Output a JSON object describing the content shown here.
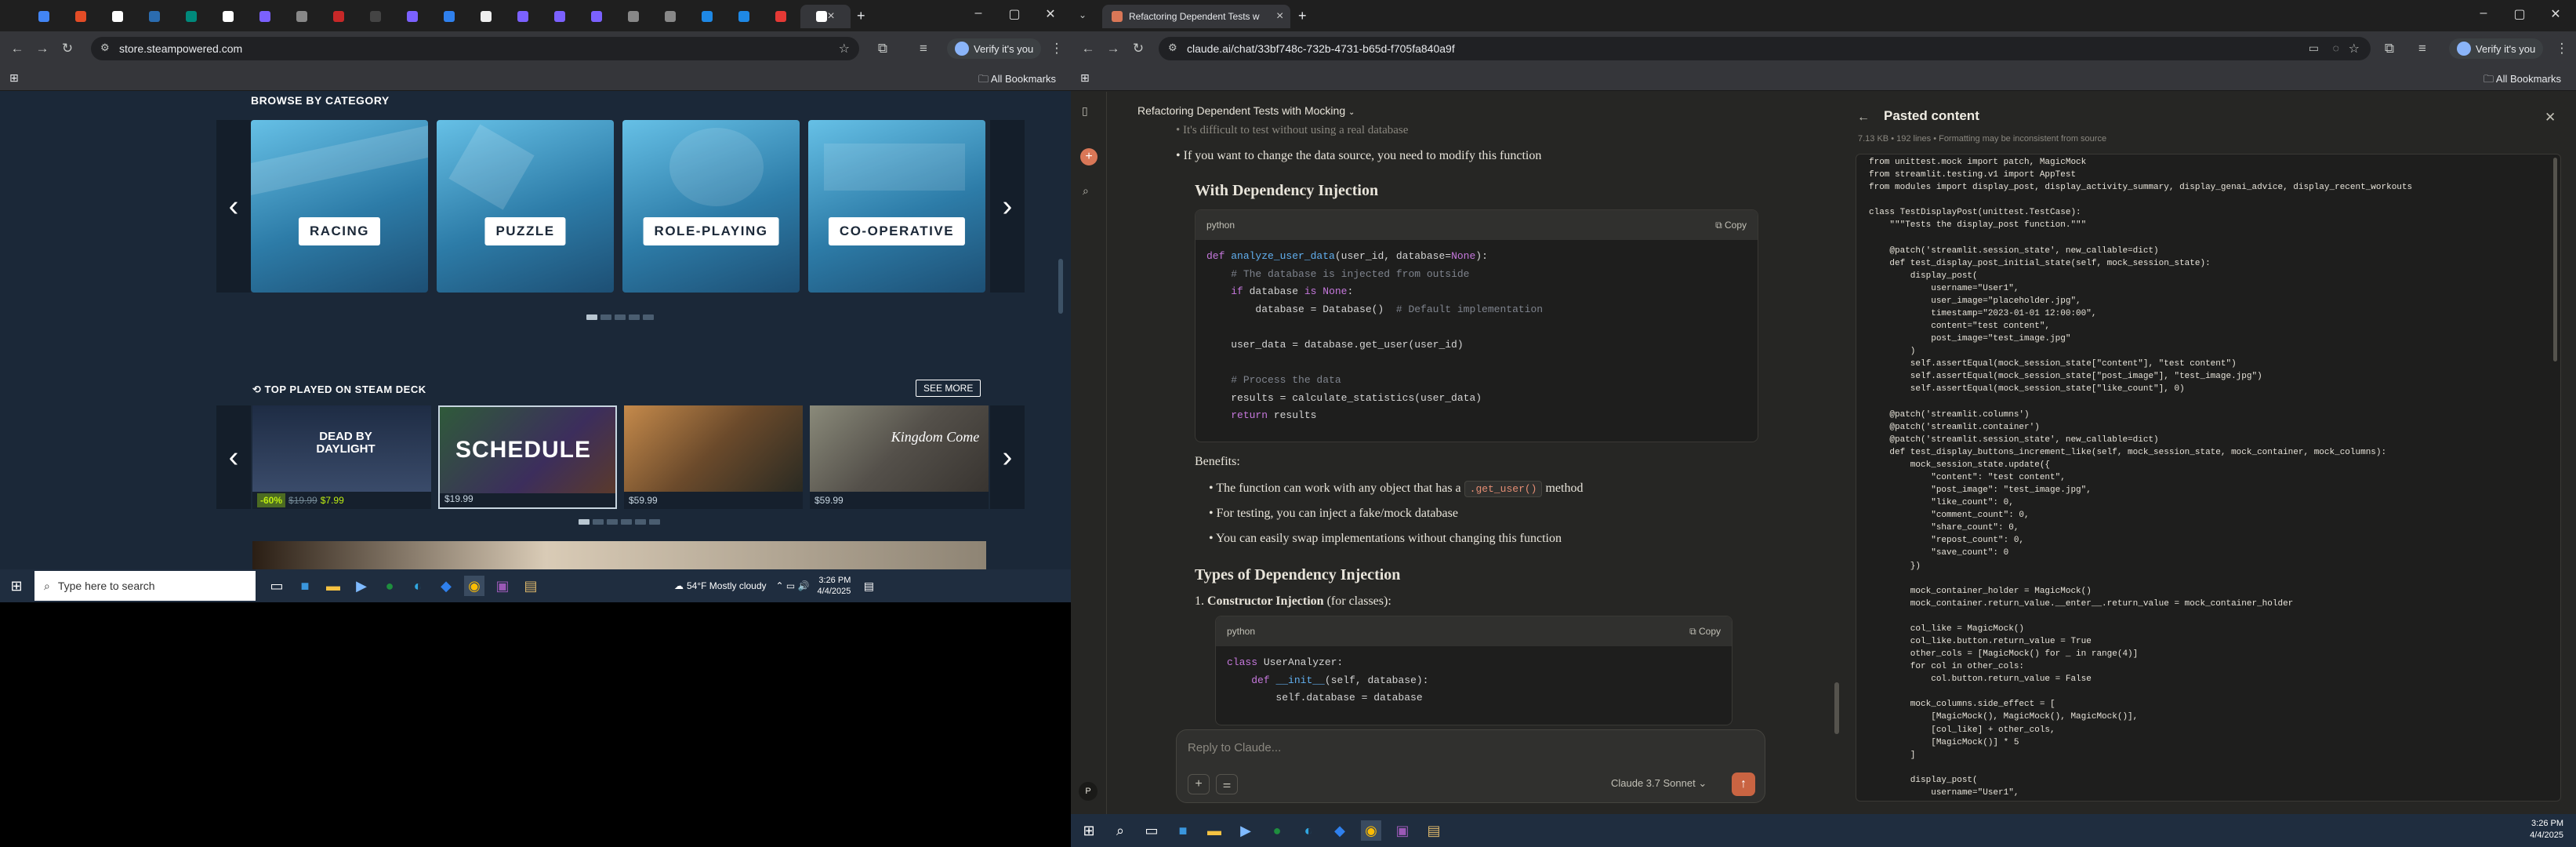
{
  "left_browser": {
    "url": "store.steampowered.com",
    "verify_label": "Verify it's you",
    "bookmarks_label": "All Bookmarks",
    "browse_heading": "BROWSE BY CATEGORY",
    "categories": [
      {
        "label": "RACING"
      },
      {
        "label": "PUZZLE"
      },
      {
        "label": "ROLE-PLAYING"
      },
      {
        "label": "CO-OPERATIVE"
      }
    ],
    "top_played_heading": "TOP PLAYED ON STEAM DECK",
    "see_more_label": "SEE MORE",
    "games": [
      {
        "discount": "-60%",
        "original": "$19.99",
        "final": "$7.99",
        "art_text": "DEAD BY DAYLIGHT",
        "color": "#2a3c55"
      },
      {
        "price": "$19.99",
        "art_text": "SCHEDULE",
        "color": "#3f2e5a"
      },
      {
        "price": "$59.99",
        "art_text": "",
        "color": "#7a5a36"
      },
      {
        "price": "$59.99",
        "art_text": "Kingdom Come",
        "color": "#5c5a52"
      }
    ],
    "taskbar": {
      "search_placeholder": "Type here to search",
      "weather": "54°F  Mostly cloudy",
      "time": "3:26 PM",
      "date": "4/4/2025"
    }
  },
  "right_browser": {
    "tab_title": "Refactoring Dependent Tests w",
    "url": "claude.ai/chat/33bf748c-732b-4731-b65d-f705fa840a9f",
    "verify_label": "Verify it's you",
    "bookmarks_label": "All Bookmarks",
    "chat_title": "Refactoring Dependent Tests with Mocking",
    "chat": {
      "partial_line": "It's difficult to test without using a real database",
      "bullet_top": "If you want to change the data source, you need to modify this function",
      "heading_di": "With Dependency Injection",
      "code1_lang": "python",
      "copy_label": "Copy",
      "code1_lines": [
        "def analyze_user_data(user_id, database=None):",
        "    # The database is injected from outside",
        "    if database is None:",
        "        database = Database()  # Default implementation",
        "",
        "    user_data = database.get_user(user_id)",
        "",
        "    # Process the data",
        "    results = calculate_statistics(user_data)",
        "    return results"
      ],
      "benefits_label": "Benefits:",
      "benefit_1_pre": "The function can work with any object that has a",
      "benefit_1_code": ".get_user()",
      "benefit_1_post": "method",
      "benefit_2": "For testing, you can inject a fake/mock database",
      "benefit_3": "You can easily swap implementations without changing this function",
      "heading_types": "Types of Dependency Injection",
      "numbered_1_bold": "Constructor Injection",
      "numbered_1_rest": "(for classes):",
      "code2_lang": "python",
      "code2_lines": [
        "class UserAnalyzer:",
        "    def __init__(self, database):",
        "        self.database = database"
      ]
    },
    "input_placeholder": "Reply to Claude...",
    "model_label": "Claude 3.7 Sonnet",
    "user_initial": "P",
    "paste_panel": {
      "title": "Pasted content",
      "meta": "7.13 KB  •  192 lines  •  Formatting may be inconsistent from source",
      "lines": [
        "from unittest.mock import patch, MagicMock",
        "from streamlit.testing.v1 import AppTest",
        "from modules import display_post, display_activity_summary, display_genai_advice, display_recent_workouts",
        "",
        "class TestDisplayPost(unittest.TestCase):",
        "    \"\"\"Tests the display_post function.\"\"\"",
        "",
        "    @patch('streamlit.session_state', new_callable=dict)",
        "    def test_display_post_initial_state(self, mock_session_state):",
        "        display_post(",
        "            username=\"User1\",",
        "            user_image=\"placeholder.jpg\",",
        "            timestamp=\"2023-01-01 12:00:00\",",
        "            content=\"test content\",",
        "            post_image=\"test_image.jpg\"",
        "        )",
        "        self.assertEqual(mock_session_state[\"content\"], \"test content\")",
        "        self.assertEqual(mock_session_state[\"post_image\"], \"test_image.jpg\")",
        "        self.assertEqual(mock_session_state[\"like_count\"], 0)",
        "",
        "    @patch('streamlit.columns')",
        "    @patch('streamlit.container')",
        "    @patch('streamlit.session_state', new_callable=dict)",
        "    def test_display_buttons_increment_like(self, mock_session_state, mock_container, mock_columns):",
        "        mock_session_state.update({",
        "            \"content\": \"test content\",",
        "            \"post_image\": \"test_image.jpg\",",
        "            \"like_count\": 0,",
        "            \"comment_count\": 0,",
        "            \"share_count\": 0,",
        "            \"repost_count\": 0,",
        "            \"save_count\": 0",
        "        })",
        "",
        "        mock_container_holder = MagicMock()",
        "        mock_container.return_value.__enter__.return_value = mock_container_holder",
        "",
        "        col_like = MagicMock()",
        "        col_like.button.return_value = True",
        "        other_cols = [MagicMock() for _ in range(4)]",
        "        for col in other_cols:",
        "            col.button.return_value = False",
        "",
        "        mock_columns.side_effect = [",
        "            [MagicMock(), MagicMock(), MagicMock()],",
        "            [col_like] + other_cols,",
        "            [MagicMock()] * 5",
        "        ]",
        "",
        "        display_post(",
        "            username=\"User1\",",
        "            user_image=\"placeholder.jpg\","
      ]
    },
    "taskbar": {
      "time": "3:26 PM",
      "date": "4/4/2025"
    }
  },
  "colors": {
    "steam_bg": "#1b2838",
    "claude_bg": "#262624",
    "accent_orange": "#d97757",
    "steam_green": "#beee11"
  }
}
